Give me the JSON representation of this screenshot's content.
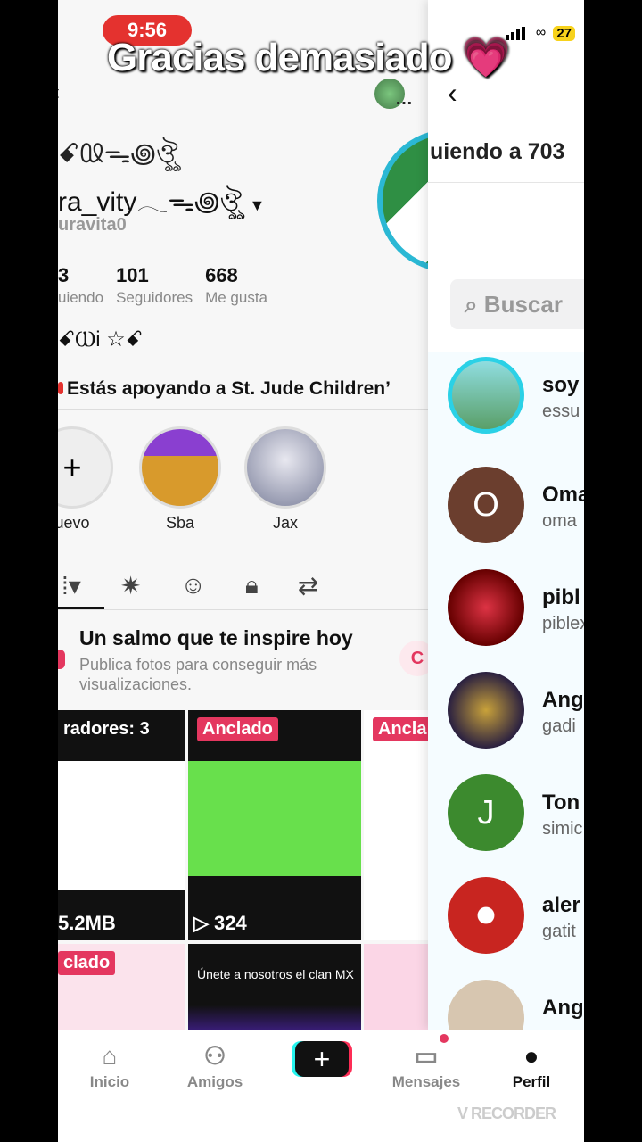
{
  "status": {
    "time": "9:56",
    "battery": "27"
  },
  "caption": {
    "text": "Gracias demasiado",
    "emoji": "💗"
  },
  "profile": {
    "deco_line": "ꗃ𖪙ᯓ꩜ঔৣ",
    "username": "ra_vity𓂃ᯓ꩜ঔৣ",
    "handle": "uravita0",
    "stats": [
      {
        "num": "3",
        "label": "uiendo"
      },
      {
        "num": "101",
        "label": "Seguidores"
      },
      {
        "num": "668",
        "label": "Me gusta"
      }
    ],
    "bio": "ꗃⲰi ☆ꗃ",
    "support": "Estás apoyando a St. Jude Children’",
    "stories": [
      {
        "label": "uevo",
        "glyph": "+"
      },
      {
        "label": "Sba",
        "glyph": ""
      },
      {
        "label": "Jax",
        "glyph": ""
      }
    ],
    "promo": {
      "title": "Un salmo que te inspire hoy",
      "subtitle": "Publica fotos para conseguir más visualizaciones.",
      "button": "C"
    },
    "grid": [
      {
        "pin": "radores: 3",
        "stat": "5.2MB"
      },
      {
        "pin": "Anclado",
        "stat": "▷ 324"
      },
      {
        "pin": "Ancla",
        "stat": ""
      },
      {
        "pin": "clado",
        "stat": ""
      },
      {
        "pin": "",
        "stat": "",
        "text": "Únete a nosotros el clan MX"
      }
    ]
  },
  "nav": {
    "items": [
      "Inicio",
      "Amigos",
      "",
      "Mensajes",
      "Perfil"
    ]
  },
  "panel": {
    "title": "uiendo a 703",
    "search_placeholder": "Buscar",
    "rows": [
      {
        "name": "soy",
        "handle": "essu",
        "color": "#4a9c6a",
        "initial": ""
      },
      {
        "name": "Oma",
        "handle": "oma",
        "color": "#6b3e2e",
        "initial": "O"
      },
      {
        "name": "pibl",
        "handle": "piblex",
        "color": "#a3121a",
        "initial": ""
      },
      {
        "name": "Ang",
        "handle": "gadi",
        "color": "#3a2a4a",
        "initial": ""
      },
      {
        "name": "Ton",
        "handle": "simic",
        "color": "#3c8a2e",
        "initial": "J"
      },
      {
        "name": "aler",
        "handle": "gatit",
        "color": "#c82520",
        "initial": ""
      },
      {
        "name": "Ang",
        "handle": "",
        "color": "#d7c6b0",
        "initial": ""
      }
    ]
  },
  "watermark": "V RECORDER"
}
